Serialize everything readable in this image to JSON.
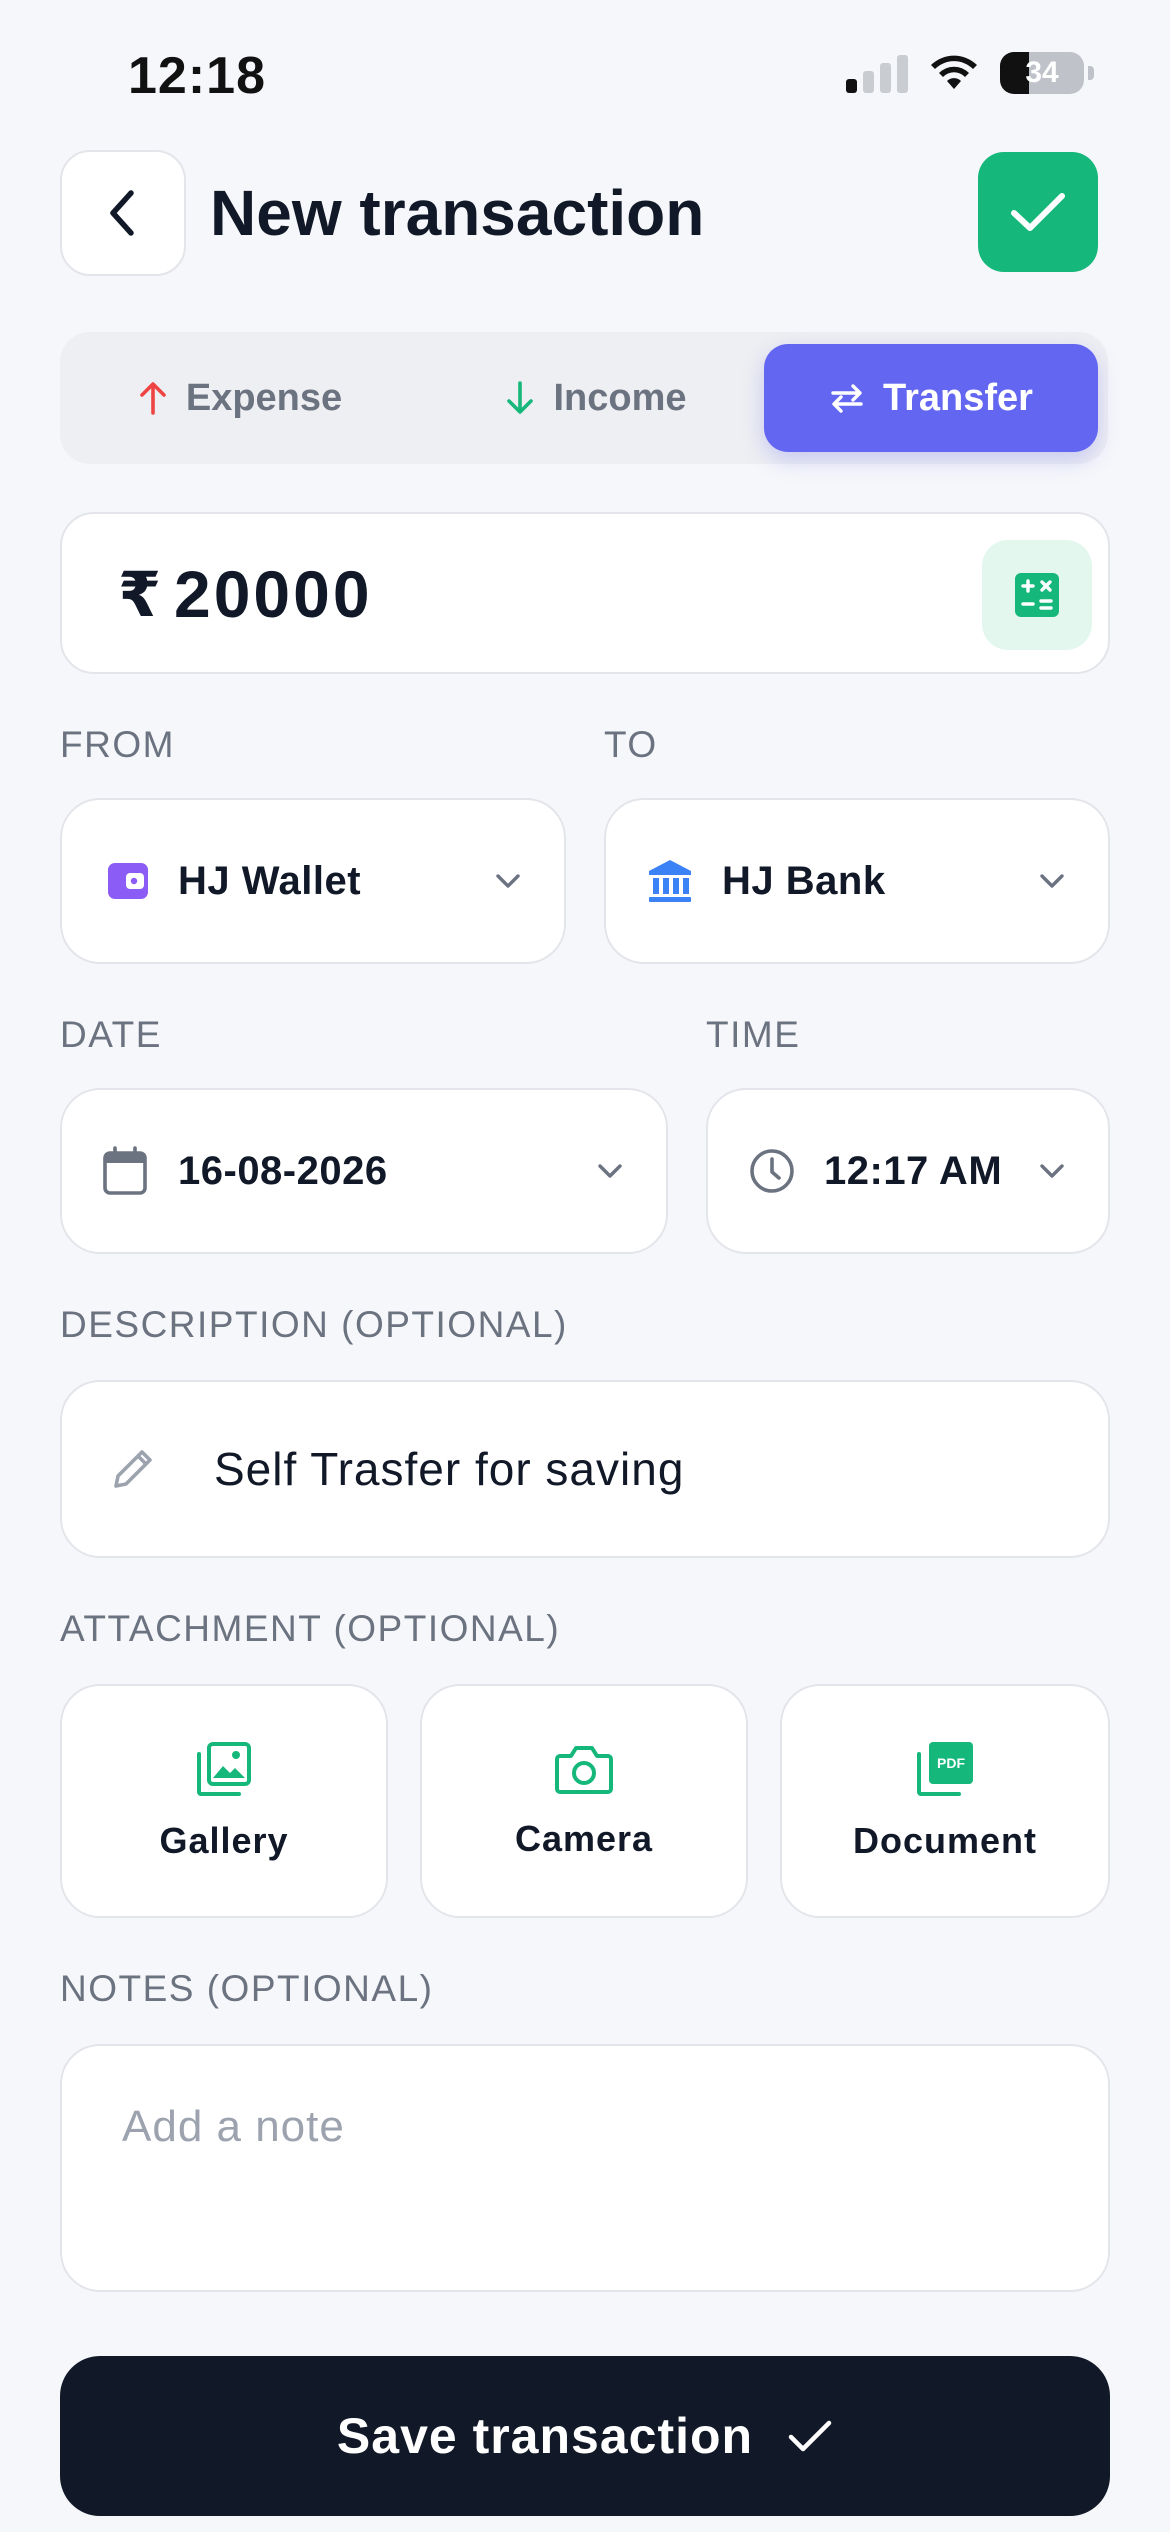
{
  "status_bar": {
    "time": "12:18",
    "battery": "34"
  },
  "header": {
    "title": "New transaction"
  },
  "type_tabs": [
    {
      "label": "Expense",
      "icon": "arrow-up-icon",
      "color": "#EF4444"
    },
    {
      "label": "Income",
      "icon": "arrow-down-icon",
      "color": "#16B77B"
    },
    {
      "label": "Transfer",
      "icon": "swap-icon",
      "selected": true
    }
  ],
  "amount": {
    "currency_symbol": "₹",
    "value": "20000"
  },
  "from": {
    "label": "FROM",
    "account": "HJ Wallet",
    "icon": "wallet-icon"
  },
  "to": {
    "label": "TO",
    "account": "HJ Bank",
    "icon": "bank-icon"
  },
  "date": {
    "label": "DATE",
    "value": "16-08-2026"
  },
  "time": {
    "label": "TIME",
    "value": "12:17 AM"
  },
  "description": {
    "label": "DESCRIPTION (OPTIONAL)",
    "value": "Self Trasfer for saving"
  },
  "attachment": {
    "label": "ATTACHMENT (OPTIONAL)",
    "options": [
      {
        "label": "Gallery",
        "icon": "gallery-icon"
      },
      {
        "label": "Camera",
        "icon": "camera-icon"
      },
      {
        "label": "Document",
        "icon": "pdf-icon"
      }
    ]
  },
  "notes": {
    "label": "NOTES (OPTIONAL)",
    "placeholder": "Add a note",
    "value": ""
  },
  "save_button": {
    "label": "Save transaction"
  },
  "colors": {
    "accent": "#6366F1",
    "success": "#16B77B",
    "dark": "#111827",
    "wallet": "#8B5CF6",
    "bank": "#3B82F6"
  }
}
